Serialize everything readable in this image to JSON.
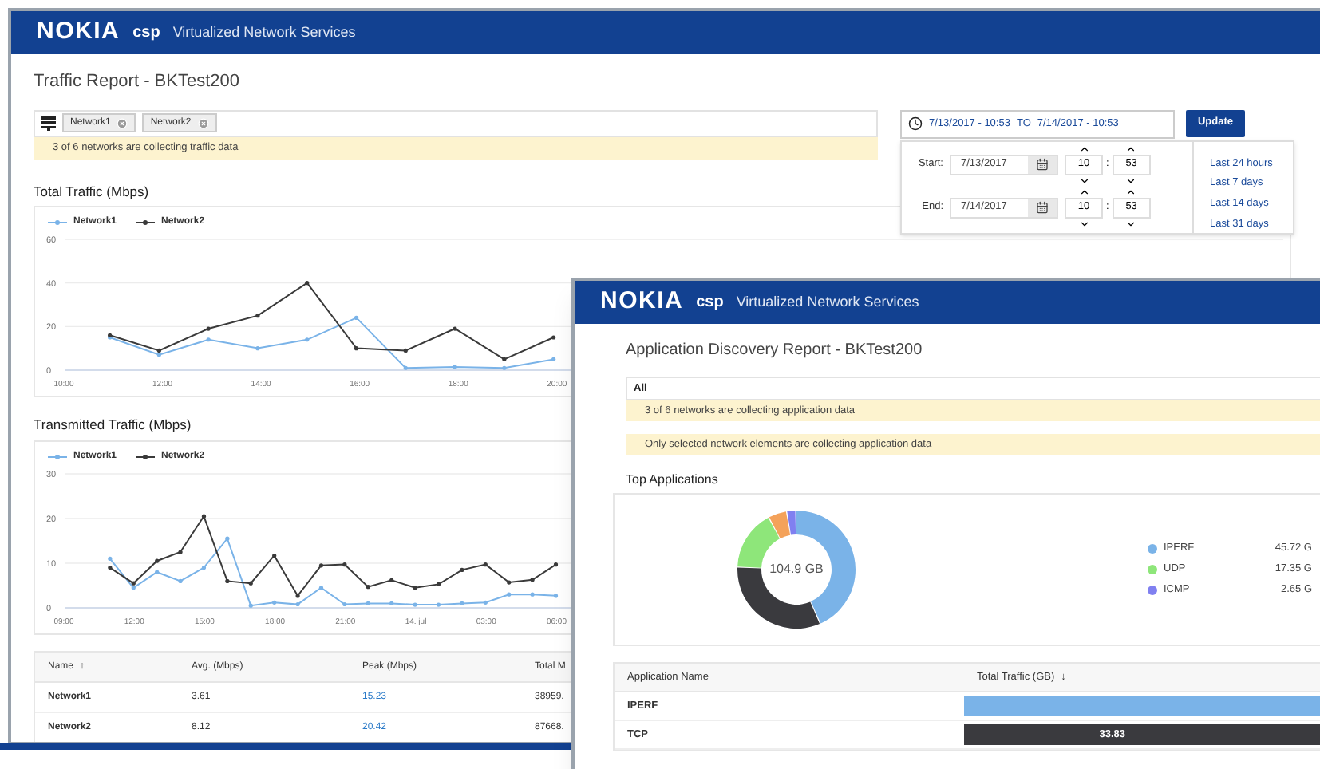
{
  "traffic_window": {
    "brand": "NOKIA",
    "product": "csp",
    "title": "Virtualized Network Services",
    "page_title": "Traffic Report - BKTest200",
    "network_chips": [
      "Network1",
      "Network2"
    ],
    "notice": "3 of 6 networks are collecting traffic data",
    "date_range": {
      "from": "7/13/2017 - 10:53",
      "separator": "TO",
      "to": "7/14/2017 - 10:53"
    },
    "update_button": "Update",
    "date_picker": {
      "rows": [
        {
          "label": "Start:",
          "date": "7/13/2017",
          "hour": "10",
          "minute": "53"
        },
        {
          "label": "End:",
          "date": "7/14/2017",
          "hour": "10",
          "minute": "53"
        }
      ],
      "time_separator": ":",
      "presets": [
        "Last 24 hours",
        "Last 7 days",
        "Last 14 days",
        "Last 31 days"
      ]
    },
    "total_chart": {
      "heading": "Total Traffic (Mbps)",
      "chart_data": {
        "type": "line",
        "xlim": [
          10,
          34.7
        ],
        "ylim": [
          0,
          60
        ],
        "xticks": [
          {
            "value": 10,
            "label": "10:00"
          },
          {
            "value": 12,
            "label": "12:00"
          },
          {
            "value": 14,
            "label": "14:00"
          },
          {
            "value": 16,
            "label": "16:00"
          },
          {
            "value": 18,
            "label": "18:00"
          },
          {
            "value": 20,
            "label": "20:00"
          }
        ],
        "yticks": [
          0,
          20,
          40,
          60
        ],
        "x": [
          10.9,
          11.9,
          12.9,
          13.9,
          14.9,
          15.9,
          16.9,
          17.9,
          18.9,
          19.9
        ],
        "series": [
          {
            "name": "Network1",
            "color": "#7ab3e8",
            "values": [
              15,
              7,
              14,
              10,
              14,
              24,
              1,
              1.5,
              1,
              5
            ]
          },
          {
            "name": "Network2",
            "color": "#3a3a3a",
            "values": [
              16,
              9,
              19,
              25,
              40,
              10,
              9,
              19,
              5,
              15
            ]
          }
        ]
      }
    },
    "transmitted_chart": {
      "heading": "Transmitted Traffic (Mbps)",
      "chart_data": {
        "type": "line",
        "xlim": [
          "2017-07-13T09:00",
          "2017-07-15T12:54"
        ],
        "ylim": [
          0,
          30
        ],
        "xticks": [
          {
            "value": "2017-07-13T09:00",
            "label": "09:00"
          },
          {
            "value": "2017-07-13T12:00",
            "label": "12:00"
          },
          {
            "value": "2017-07-13T15:00",
            "label": "15:00"
          },
          {
            "value": "2017-07-13T18:00",
            "label": "18:00"
          },
          {
            "value": "2017-07-13T21:00",
            "label": "21:00"
          },
          {
            "value": "2017-07-14T00:00",
            "label": "14. jul"
          },
          {
            "value": "2017-07-14T03:00",
            "label": "03:00"
          },
          {
            "value": "2017-07-14T06:00",
            "label": "06:00"
          }
        ],
        "yticks": [
          0,
          10,
          20,
          30
        ],
        "x": [
          "2017-07-13T10:54",
          "2017-07-13T11:54",
          "2017-07-13T12:54",
          "2017-07-13T13:54",
          "2017-07-13T14:54",
          "2017-07-13T15:54",
          "2017-07-13T16:54",
          "2017-07-13T17:54",
          "2017-07-13T18:54",
          "2017-07-13T19:54",
          "2017-07-13T20:54",
          "2017-07-13T21:54",
          "2017-07-13T22:54",
          "2017-07-13T23:54",
          "2017-07-14T00:54",
          "2017-07-14T01:54",
          "2017-07-14T02:54",
          "2017-07-14T03:54",
          "2017-07-14T04:54",
          "2017-07-14T05:54"
        ],
        "series": [
          {
            "name": "Network1",
            "color": "#7ab3e8",
            "values": [
              11,
              4.5,
              8,
              6,
              9,
              15.5,
              0.5,
              1.2,
              0.8,
              4.5,
              0.8,
              1,
              1,
              0.7,
              0.7,
              1,
              1.2,
              3,
              3,
              2.7
            ]
          },
          {
            "name": "Network2",
            "color": "#3a3a3a",
            "values": [
              9,
              5.5,
              10.5,
              12.5,
              20.5,
              6,
              5.5,
              11.7,
              2.7,
              9.5,
              9.7,
              4.7,
              6.2,
              4.5,
              5.3,
              8.5,
              9.7,
              5.7,
              6.3,
              9.7
            ]
          }
        ]
      }
    },
    "table": {
      "columns": [
        {
          "label": "Name",
          "sort_mark": "↑",
          "kind": "text"
        },
        {
          "label": "Avg. (Mbps)",
          "kind": "text"
        },
        {
          "label": "Peak (Mbps)",
          "kind": "link"
        },
        {
          "label": "Total M",
          "kind": "text"
        }
      ],
      "rows": [
        [
          "Network1",
          "3.61",
          "15.23",
          "38959."
        ],
        [
          "Network2",
          "8.12",
          "20.42",
          "87668."
        ]
      ]
    }
  },
  "app_window": {
    "brand": "NOKIA",
    "product": "csp",
    "title": "Virtualized Network Services",
    "page_title": "Application Discovery Report - BKTest200",
    "filter": "All",
    "notices": [
      "3 of 6 networks are collecting application data",
      "Only selected network elements are collecting application data"
    ],
    "section_heading": "Top Applications",
    "donut": {
      "center_label": "104.9 GB",
      "chart_data": {
        "type": "donut",
        "values": [
          43.58,
          32.25,
          16.54,
          5.1,
          2.53
        ],
        "colors": [
          "#7ab3e8",
          "#3a3a3e",
          "#8ee67a",
          "#f4a25a",
          "#8080f0"
        ]
      }
    },
    "legend": [
      {
        "name": "IPERF",
        "value": "45.72 G",
        "color": "#7ab3e8"
      },
      {
        "name": "UDP",
        "value": "17.35 G",
        "color": "#8ee67a"
      },
      {
        "name": "ICMP",
        "value": "2.65 G",
        "color": "#8080f0"
      }
    ],
    "table": {
      "columns": [
        {
          "label": "Application Name"
        },
        {
          "label": "Total Traffic (GB)",
          "sort_mark": "↓"
        }
      ],
      "rows": [
        {
          "name": "IPERF",
          "color": "#7ab3e8"
        },
        {
          "name": "TCP",
          "color": "#3a3a3e",
          "value": "33.83"
        }
      ]
    }
  }
}
